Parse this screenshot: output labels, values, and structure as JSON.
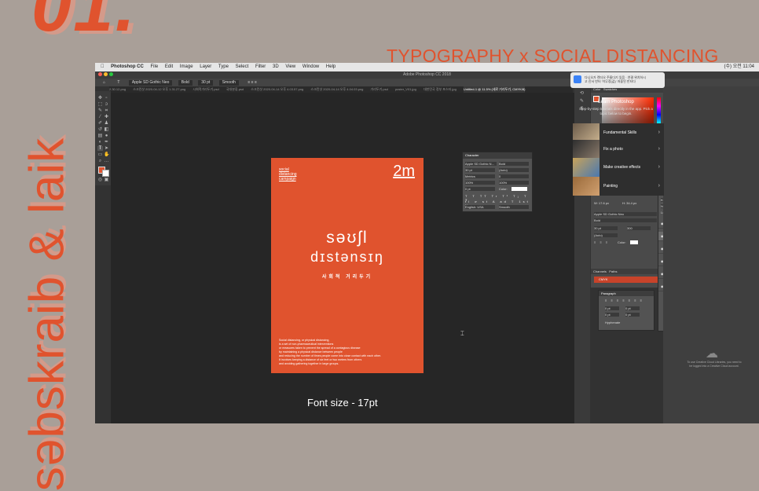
{
  "slide": {
    "number": "01.",
    "banner": "TYPOGRAPHY x SOCIAL DISTANCING",
    "vertical": "səbskraib & laik",
    "caption": "Font size - 17pt"
  },
  "menubar": {
    "app": "Photoshop CC",
    "items": [
      "File",
      "Edit",
      "Image",
      "Layer",
      "Type",
      "Select",
      "Filter",
      "3D",
      "View",
      "Window",
      "Help"
    ],
    "right": "(수) 오전 11:04"
  },
  "window": {
    "title": "Adobe Photoshop CC 2018"
  },
  "options": {
    "font": "Apple SD Gothic Neo",
    "style": "Bold",
    "size": "30 pt",
    "aa": "Smooth"
  },
  "tabs": [
    {
      "label": "2.30.12.png"
    },
    {
      "label": "스크린샷 2020-04-12 오후 1.31.27.png"
    },
    {
      "label": "시회적거리두기.psd"
    },
    {
      "label": "국대분류.psd"
    },
    {
      "label": "스크린샷 2020-04-14 오후 4.03.57.png"
    },
    {
      "label": "스크린샷 2020-04-14 오후 4.04.03.png"
    },
    {
      "label": "거리두기.psd"
    },
    {
      "label": "poster_V01.jpg"
    },
    {
      "label": "대한민국 정부 포스터.jpg"
    },
    {
      "label": "Untitled-1 @ 11.5% (세로 거리두기, CMYK/8)",
      "active": true
    }
  ],
  "poster": {
    "campaign": [
      "social",
      "distancing",
      "campaign"
    ],
    "distance": "2m",
    "title1": "səʊʃl",
    "title2": "dɪstənsɪŋ",
    "korean": "사회적 거리두기",
    "body": [
      "Social distancing, or physical distancing,",
      "is a set of non-pharmaceutical interventions",
      "or measures taken to prevent the spread of a contagious disease",
      "by maintaining a physical distance between people",
      "and reducing the number of times people come into close contact with each other.",
      "It involves keeping a distance of six feet or two meters from others",
      "and avoiding gathering together in large groups."
    ]
  },
  "character_panel": {
    "title": "Character",
    "font": "Apple SD Gothic N...",
    "style": "Bold",
    "size": "30 pt",
    "leading": "(Auto)",
    "kerning": "Metrics",
    "tracking": "0",
    "vscale": "100%",
    "hscale": "100%",
    "baseline": "0 pt",
    "color_label": "Color:",
    "language": "English: USA",
    "aa": "Smooth"
  },
  "color_panel": {
    "tabs": [
      "Color",
      "Swatches"
    ]
  },
  "properties_panel": {
    "tabs": [
      "Properties",
      "Adjustments"
    ],
    "section": "Type Layer Properties",
    "w": "W: 17.6 px",
    "h": "H: 34.4 px",
    "font": "Apple SD Gothic Neo",
    "style": "Bold",
    "size": "30 pt",
    "tracking": "300",
    "leading": "(Auto)",
    "color": "Color:"
  },
  "channels_panel": {
    "tabs": [
      "Channels",
      "Paths"
    ],
    "row": "CMYK"
  },
  "paragraph_panel": {
    "title": "Paragraph",
    "indent": "0 pt",
    "space": "0 pt",
    "hyphenate": "Hyphenate"
  },
  "layers_panel": {
    "title": "Layers",
    "kind": "Kind",
    "mode": "Normal",
    "opacity": "Opacity: 100%",
    "fill": "Fill: 100%",
    "layers": [
      {
        "name": "Social distanc... of non-phar",
        "type": "T"
      },
      {
        "name": "사회적 거리두기",
        "type": "T",
        "selected": true
      },
      {
        "name": "səʊʃl dɪstənsɪŋ",
        "type": "T"
      },
      {
        "name": "2m",
        "type": "T"
      },
      {
        "name": "social distancing campaign",
        "type": "T"
      },
      {
        "name": "Background",
        "type": "bg"
      }
    ]
  },
  "learn_panel": {
    "notification": "다니오가 렌더오 주름다기 있음 · 연결 위치하시고 진서 만터 '이무정(값)' 저을된 만터다",
    "title": "Learn Photoshop",
    "subtitle": "Step-by-step tutorials directly in the app. Pick a topic below to begin.",
    "cards": [
      {
        "label": "Fundamental Skills"
      },
      {
        "label": "Fix a photo"
      },
      {
        "label": "Make creative effects"
      },
      {
        "label": "Painting"
      }
    ],
    "cc_message": "To use Creative Cloud Libraries, you need to be logged into a Creative Cloud account."
  },
  "colors": {
    "accent": "#e0532e",
    "ps_bg": "#323232",
    "canvas": "#262626"
  }
}
